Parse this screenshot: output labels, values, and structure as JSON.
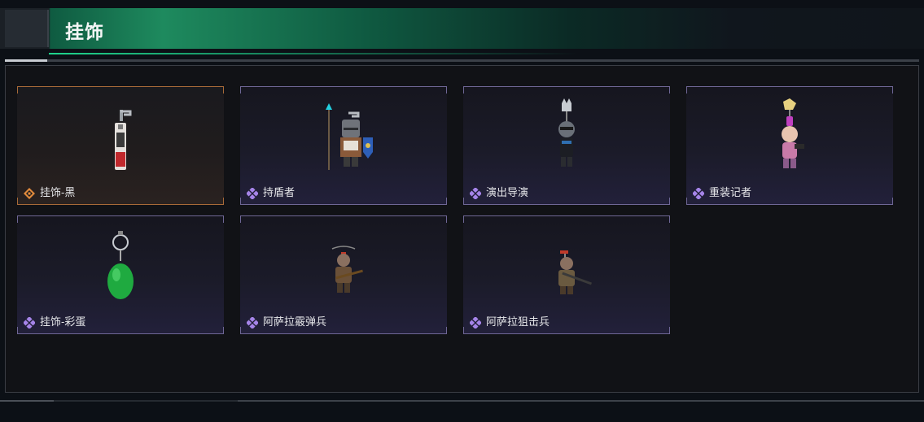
{
  "header": {
    "title": "挂饰"
  },
  "colors": {
    "accent_green": "#1fd58d",
    "rare_purple": "#a584e8",
    "legendary_orange": "#e08a3c"
  },
  "items": [
    {
      "label": "挂饰-黑",
      "rarity": "legendary",
      "icon": "keychain-tag-icon"
    },
    {
      "label": "持盾者",
      "rarity": "rare",
      "icon": "shield-knight-icon"
    },
    {
      "label": "演出导演",
      "rarity": "rare",
      "icon": "director-figure-icon"
    },
    {
      "label": "重装记者",
      "rarity": "rare",
      "icon": "reporter-figure-icon"
    },
    {
      "label": "挂饰-彩蛋",
      "rarity": "rare",
      "icon": "green-egg-icon"
    },
    {
      "label": "阿萨拉霰弹兵",
      "rarity": "rare",
      "icon": "shotgunner-figure-icon"
    },
    {
      "label": "阿萨拉狙击兵",
      "rarity": "rare",
      "icon": "sniper-figure-icon"
    }
  ]
}
